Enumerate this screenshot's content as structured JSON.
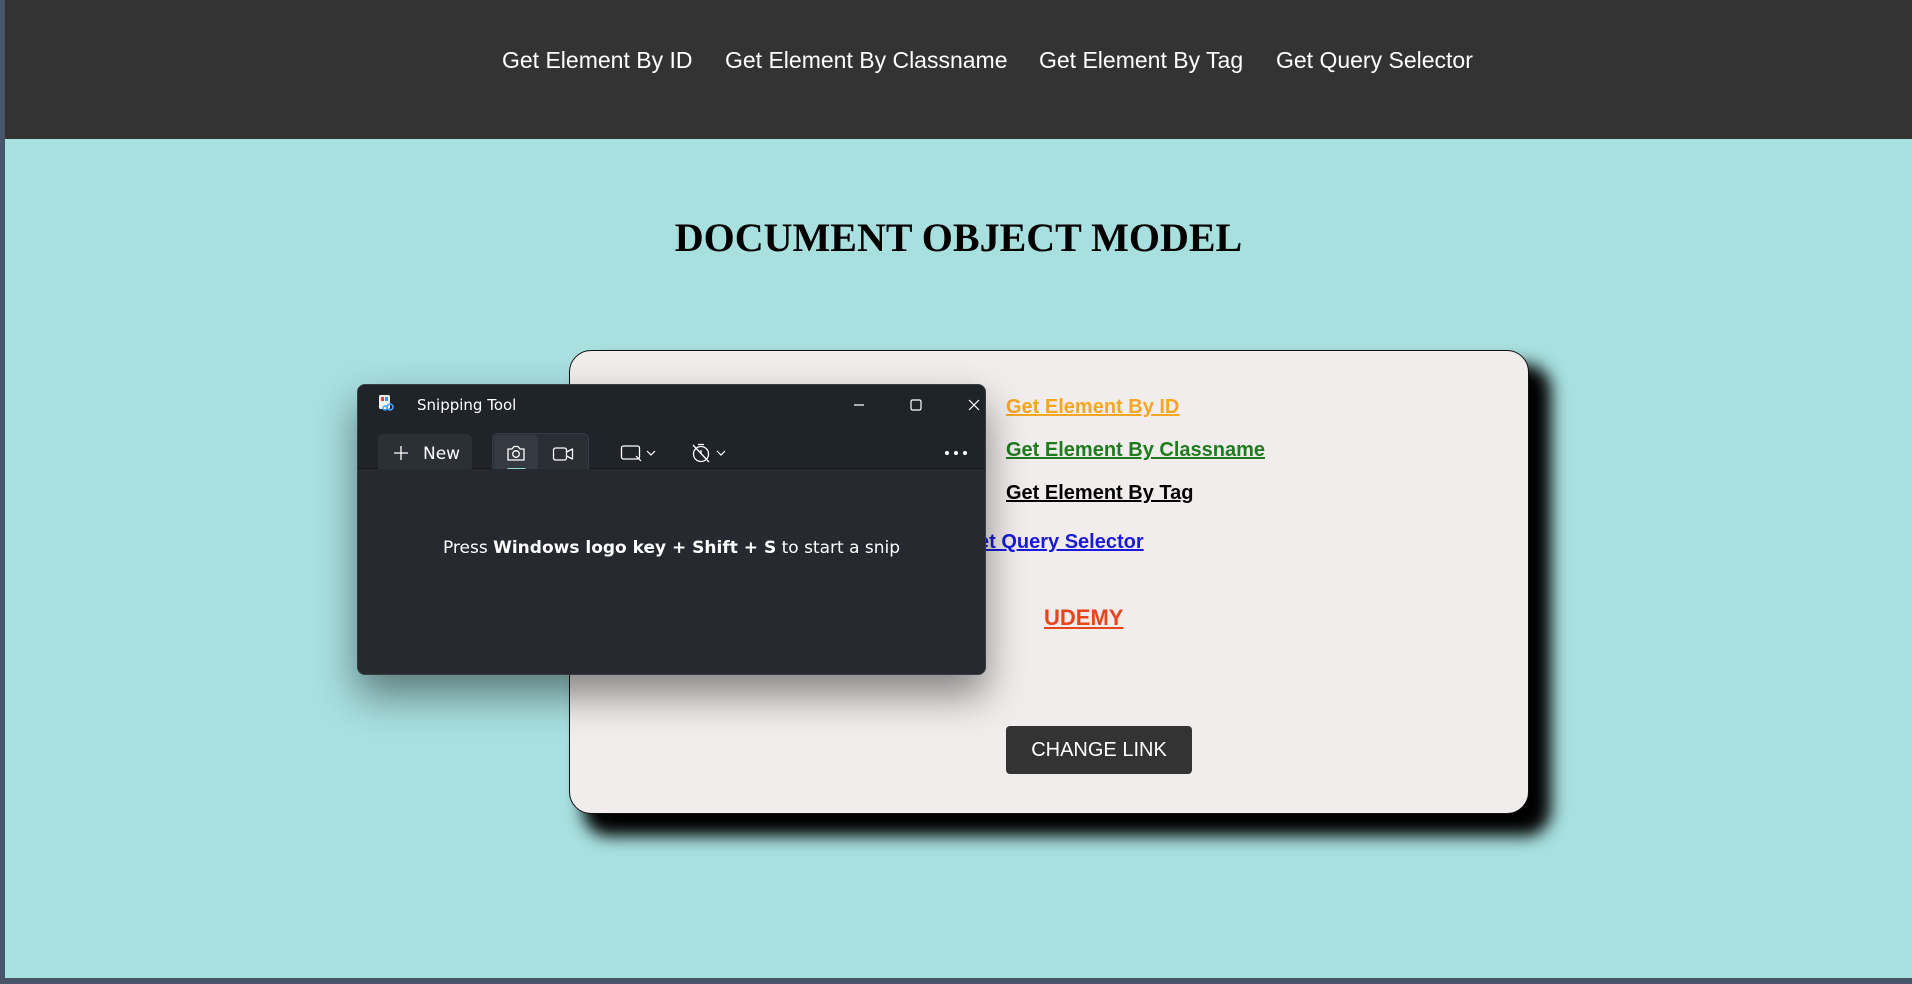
{
  "nav": {
    "links": [
      "Get Element By ID",
      "Get Element By Classname",
      "Get Element By Tag",
      "Get Query Selector"
    ]
  },
  "page": {
    "title": "DOCUMENT OBJECT MODEL"
  },
  "card": {
    "link_by_id": {
      "label": "Get Element By ID",
      "color": "#f5a623"
    },
    "link_by_classname": {
      "label": "Get Element By Classname",
      "color": "#1e7b1e"
    },
    "link_by_tag": {
      "label": "Get Element By Tag",
      "color": "#000000"
    },
    "link_query_selector": {
      "label": "et Query Selector",
      "color": "#1a1adb"
    },
    "udemy_link": {
      "label": "UDEMY",
      "color": "#e8441d"
    },
    "change_link_button": "CHANGE LINK"
  },
  "snipping_tool": {
    "title": "Snipping Tool",
    "new_button": "New",
    "hint": {
      "prefix": "Press ",
      "keys": "Windows logo key + Shift + S",
      "suffix": " to start a snip"
    },
    "icons": [
      "app-icon",
      "minimize-icon",
      "maximize-icon",
      "close-icon",
      "plus-icon",
      "camera-icon",
      "video-icon",
      "rectangle-snip-icon",
      "chevron-down-icon",
      "timer-off-icon",
      "more-icon"
    ]
  },
  "colors": {
    "nav_bg": "#333333",
    "page_bg": "#a8dfdf",
    "card_bg": "#f2eded",
    "snip_bg": "#202329"
  }
}
